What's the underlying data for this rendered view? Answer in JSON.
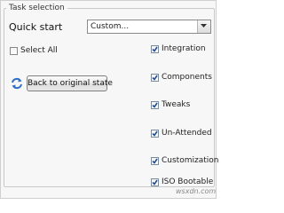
{
  "group": {
    "title": "Task selection"
  },
  "quick_start": {
    "label": "Quick start",
    "selected": "Custom..."
  },
  "select_all": {
    "label": "Select All",
    "checked": false
  },
  "reset_button": {
    "label": "Back to original state",
    "icon": "refresh-arrows-icon"
  },
  "tasks": [
    {
      "label": "Integration",
      "checked": true
    },
    {
      "label": "Components",
      "checked": true
    },
    {
      "label": "Tweaks",
      "checked": true
    },
    {
      "label": "Un-Attended",
      "checked": true
    },
    {
      "label": "Customization",
      "checked": true
    },
    {
      "label": "ISO Bootable",
      "checked": true
    }
  ],
  "watermark": "wsxdn.com",
  "colors": {
    "checkmark": "#2b4a8a",
    "icon_blue": "#2f6fc8"
  }
}
